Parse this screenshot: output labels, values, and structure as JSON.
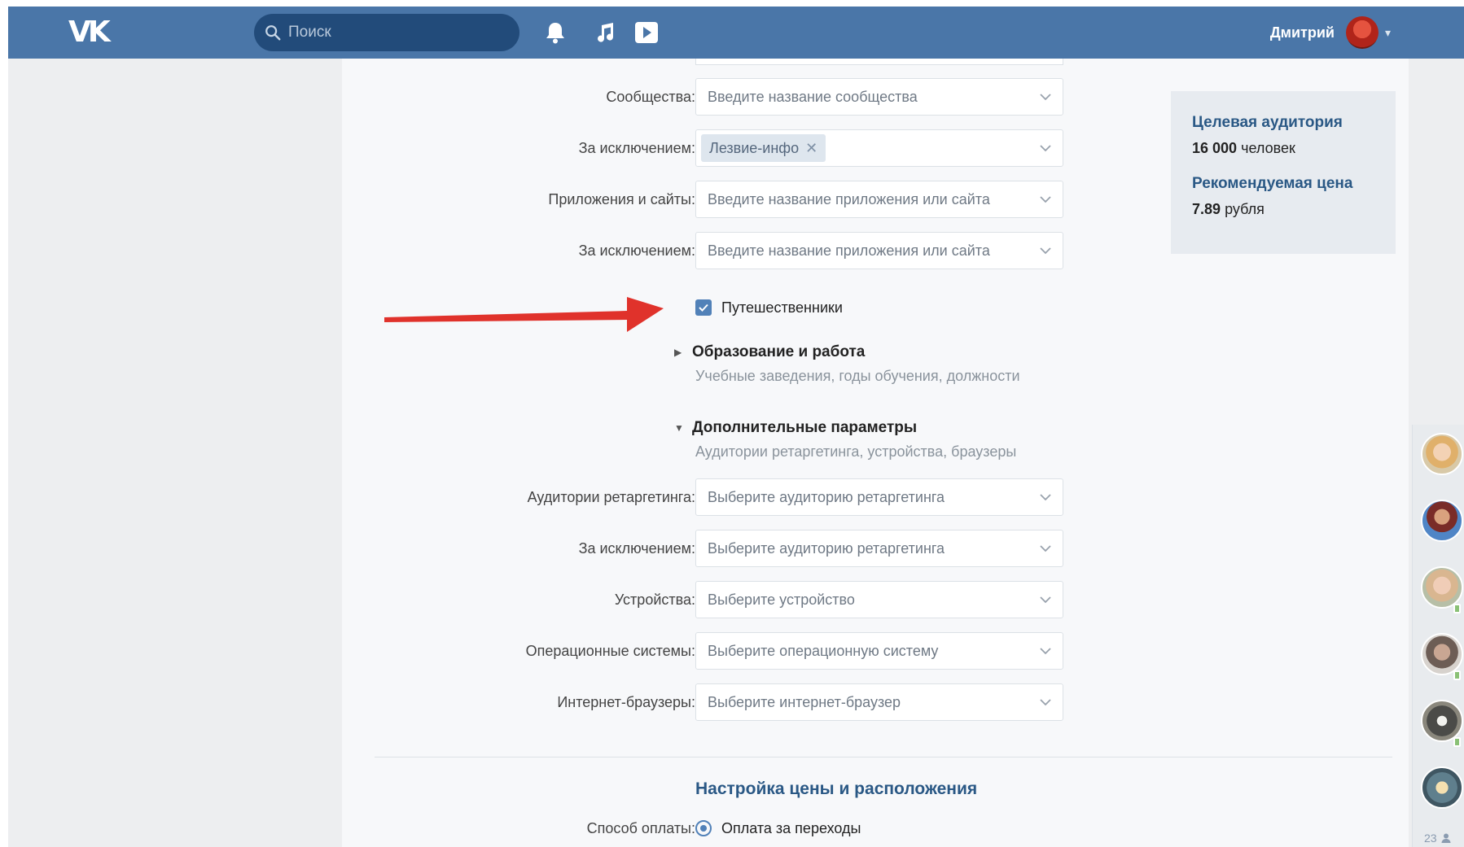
{
  "header": {
    "logo": "VK",
    "search_placeholder": "Поиск",
    "user_name": "Дмитрий",
    "icons": [
      "search-icon",
      "bell-icon",
      "music-icon",
      "video-icon",
      "chevron-down-icon"
    ]
  },
  "form": {
    "rows": [
      {
        "label": "Сообщества:",
        "placeholder": "Введите название сообщества"
      },
      {
        "label": "За исключением:",
        "tag": "Лезвие-инфо"
      },
      {
        "label": "Приложения и сайты:",
        "placeholder": "Введите название приложения или сайта"
      },
      {
        "label": "За исключением:",
        "placeholder": "Введите название приложения или сайта"
      }
    ],
    "travelers_checkbox": {
      "label": "Путешественники",
      "checked": true
    },
    "education": {
      "title": "Образование и работа",
      "subtitle": "Учебные заведения, годы обучения, должности"
    },
    "additional": {
      "title": "Дополнительные параметры",
      "subtitle": "Аудитории ретаргетинга, устройства, браузеры"
    },
    "extra_rows": [
      {
        "label": "Аудитории ретаргетинга:",
        "placeholder": "Выберите аудиторию ретаргетинга"
      },
      {
        "label": "За исключением:",
        "placeholder": "Выберите аудиторию ретаргетинга"
      },
      {
        "label": "Устройства:",
        "placeholder": "Выберите устройство"
      },
      {
        "label": "Операционные системы:",
        "placeholder": "Выберите операционную систему"
      },
      {
        "label": "Интернет-браузеры:",
        "placeholder": "Выберите интернет-браузер"
      }
    ],
    "price_section_title": "Настройка цены и расположения",
    "payment": {
      "label": "Способ оплаты:",
      "value": "Оплата за переходы"
    }
  },
  "audience": {
    "target_title": "Целевая аудитория",
    "target_count": "16 000",
    "target_unit": "человек",
    "price_title": "Рекомендуемая цена",
    "price_value": "7.89",
    "price_unit": "рубля"
  },
  "friends": {
    "count": "23"
  },
  "colors": {
    "header": "#4a76a8",
    "link": "#2a5885",
    "accent": "#5181b8",
    "arrow": "#e0322b"
  }
}
